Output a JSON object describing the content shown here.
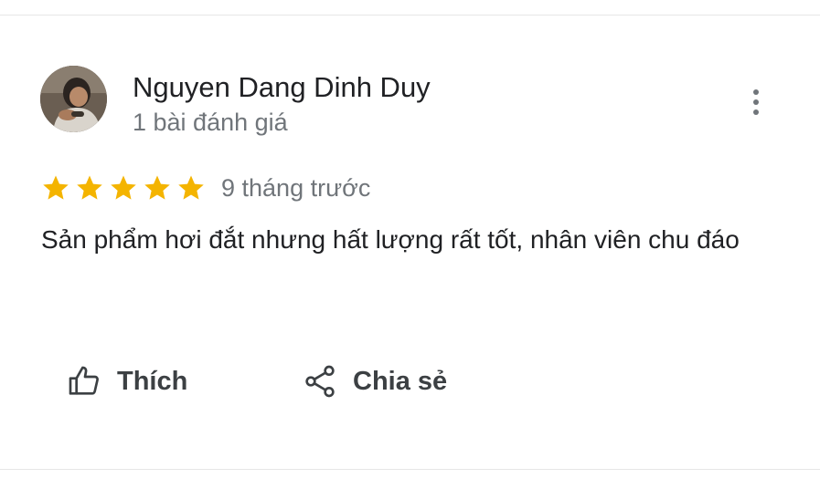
{
  "review": {
    "reviewer": {
      "name": "Nguyen Dang Dinh Duy",
      "review_count": "1 bài đánh giá"
    },
    "rating": 5,
    "max_rating": 5,
    "time": "9 tháng trước",
    "text": "Sản phẩm hơi đắt nhưng hất lượng rất tốt, nhân viên chu đáo"
  },
  "actions": {
    "like_label": "Thích",
    "share_label": "Chia sẻ",
    "more_icon": "more-vert-icon",
    "like_icon": "thumb-up-icon",
    "share_icon": "share-icon"
  },
  "colors": {
    "star": "#f4b400",
    "name": "#202124",
    "secondary": "#70757a",
    "action": "#3c4043"
  }
}
